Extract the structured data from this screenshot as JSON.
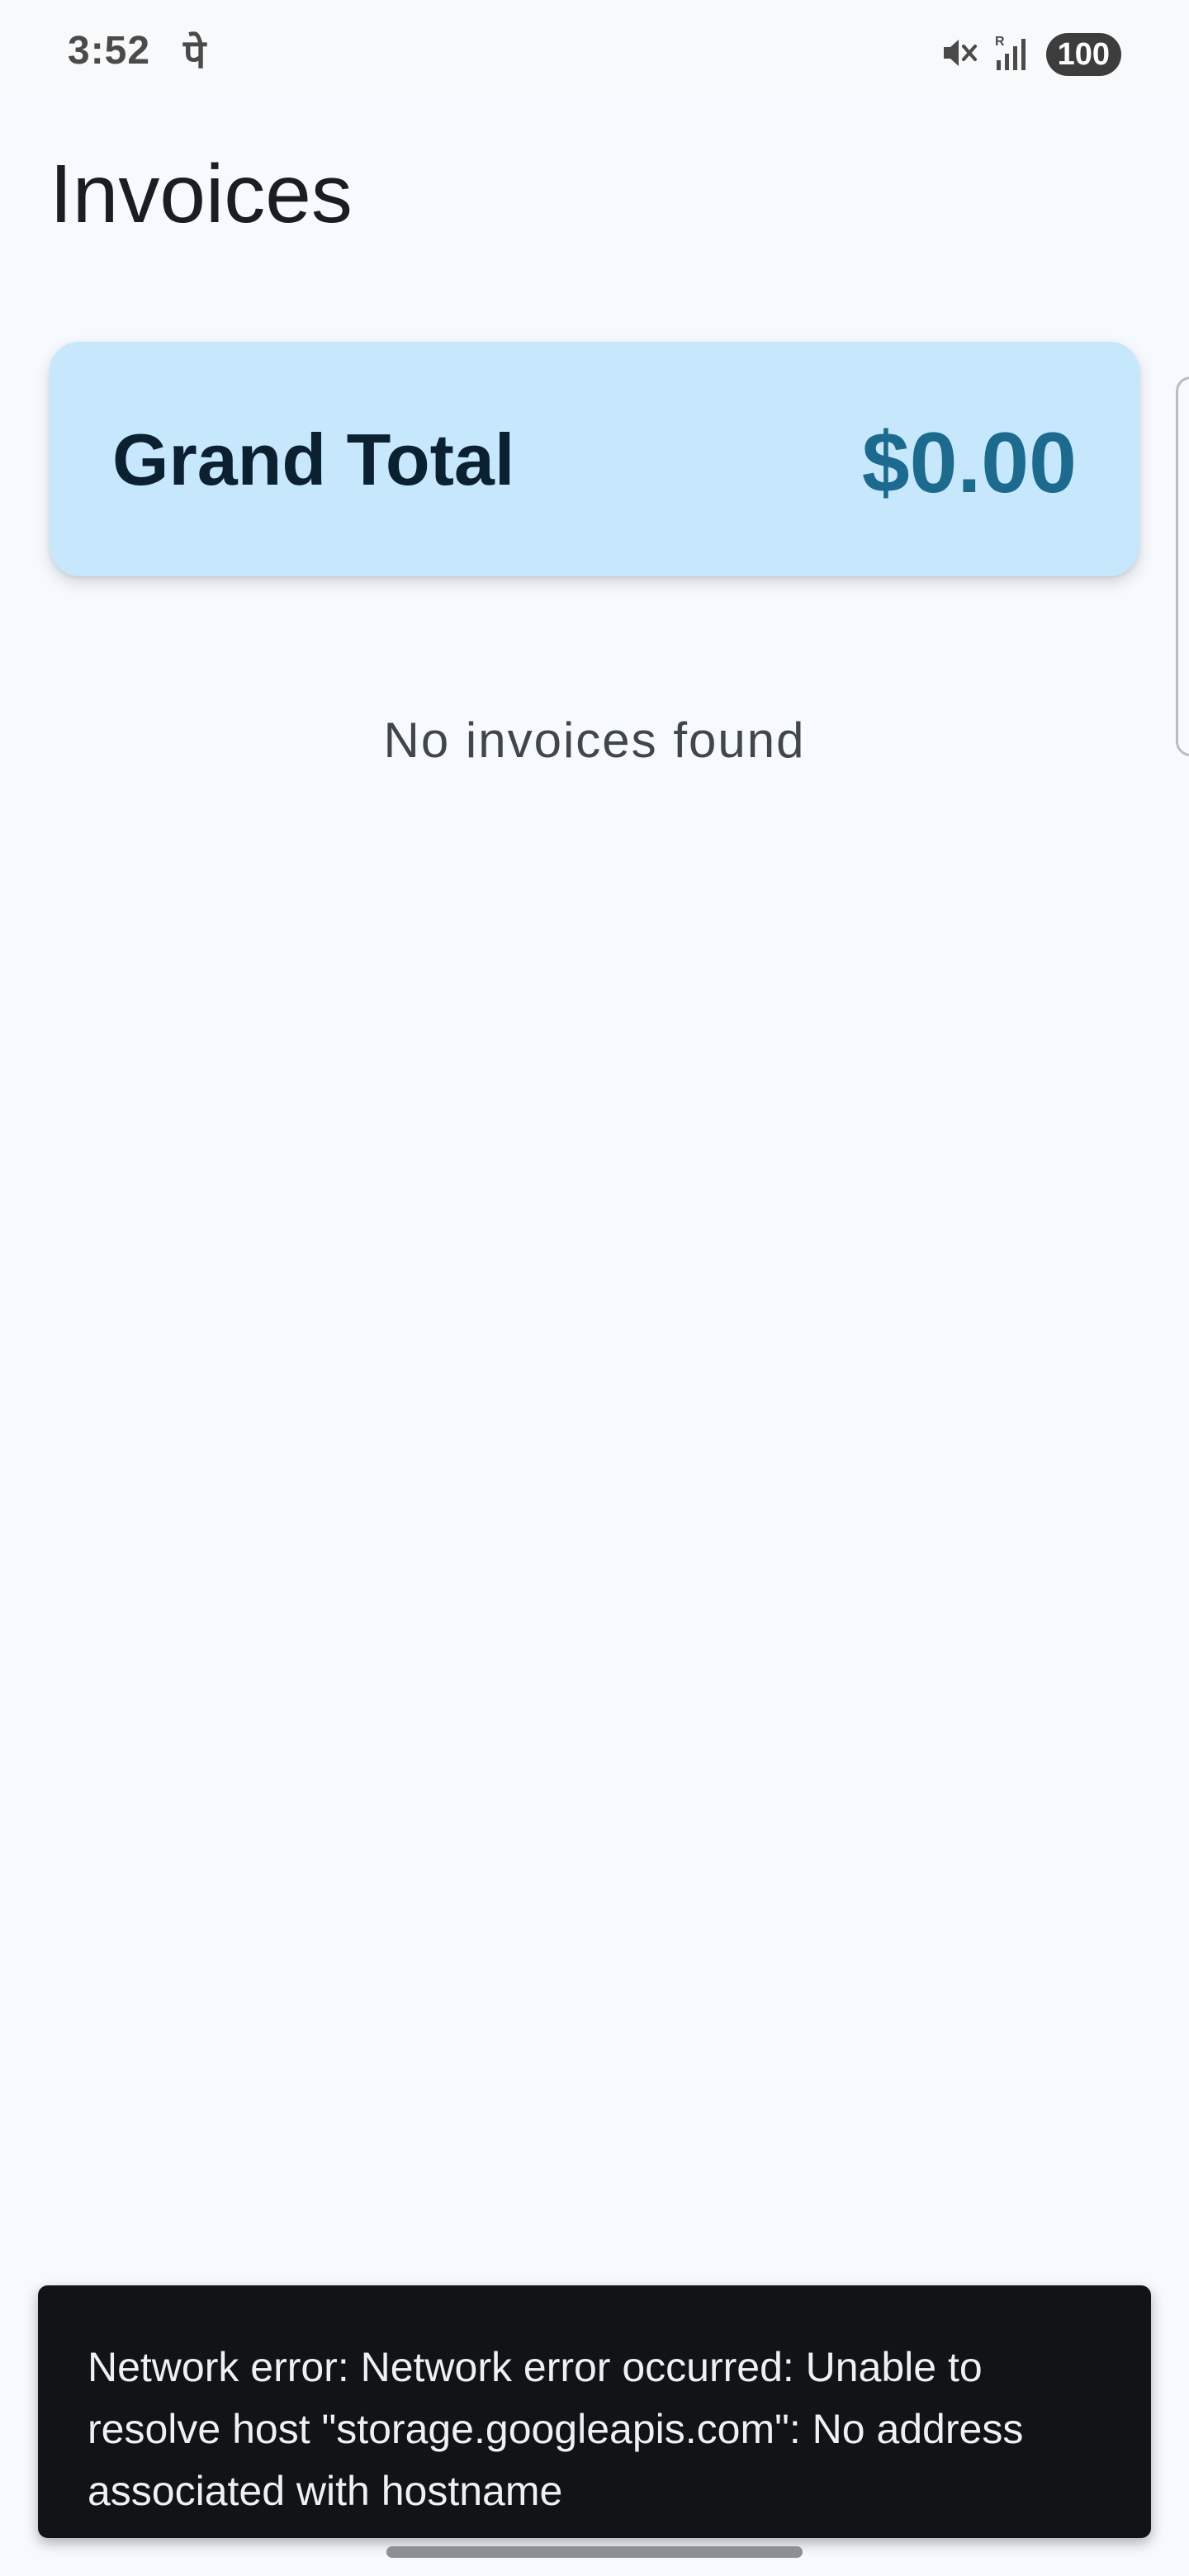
{
  "status_bar": {
    "time": "3:52",
    "carrier_glyph": "पे",
    "icons": [
      "mute-icon",
      "signal-icon"
    ],
    "battery": "100"
  },
  "header": {
    "title": "Invoices"
  },
  "summary": {
    "label": "Grand Total",
    "value": "$0.00"
  },
  "list": {
    "empty_message": "No invoices found"
  },
  "snackbar": {
    "message": "Network error: Network error occurred: Unable to resolve host \"storage.googleapis.com\": No address associated with hostname"
  },
  "colors": {
    "background": "#f6f9fe",
    "card": "#c6e7fc",
    "accent": "#1c6a8e",
    "snackbar": "#111417"
  }
}
